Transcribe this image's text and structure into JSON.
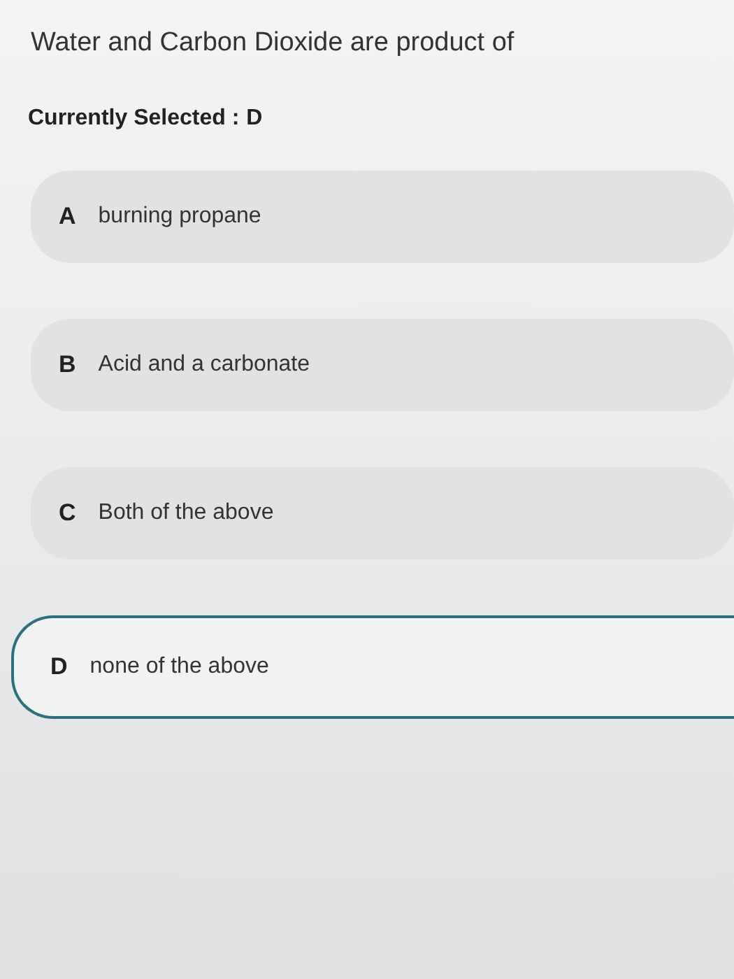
{
  "question": "Water and Carbon Dioxide are product of",
  "current": {
    "label": "Currently Selected :",
    "value": "D"
  },
  "options": [
    {
      "letter": "A",
      "text": "burning propane",
      "selected": false
    },
    {
      "letter": "B",
      "text": "Acid and a carbonate",
      "selected": false
    },
    {
      "letter": "C",
      "text": "Both of the above",
      "selected": false
    },
    {
      "letter": "D",
      "text": "none of the above",
      "selected": true
    }
  ]
}
